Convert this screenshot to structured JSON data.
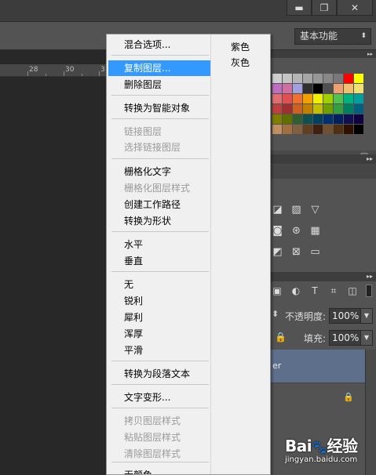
{
  "window": {
    "minimize_glyph": "▬",
    "restore_glyph": "❐",
    "close_glyph": "✕"
  },
  "options_bar": {
    "workspace_label": "基本功能",
    "workspace_arrow": "⬍"
  },
  "ruler": {
    "ticks": [
      "28",
      "30",
      "3"
    ]
  },
  "context_menu": {
    "items": [
      {
        "label": "混合选项...",
        "state": "normal"
      },
      {
        "label": "复制图层...",
        "state": "highlighted"
      },
      {
        "label": "删除图层",
        "state": "normal"
      },
      {
        "label": "转换为智能对象",
        "state": "normal"
      },
      {
        "label": "链接图层",
        "state": "disabled"
      },
      {
        "label": "选择链接图层",
        "state": "disabled"
      },
      {
        "label": "栅格化文字",
        "state": "normal"
      },
      {
        "label": "栅格化图层样式",
        "state": "disabled"
      },
      {
        "label": "创建工作路径",
        "state": "normal"
      },
      {
        "label": "转换为形状",
        "state": "normal"
      },
      {
        "label": "水平",
        "state": "normal"
      },
      {
        "label": "垂直",
        "state": "normal"
      },
      {
        "label": "无",
        "state": "normal"
      },
      {
        "label": "锐利",
        "state": "normal"
      },
      {
        "label": "犀利",
        "state": "normal"
      },
      {
        "label": "浑厚",
        "state": "normal"
      },
      {
        "label": "平滑",
        "state": "normal"
      },
      {
        "label": "转换为段落文本",
        "state": "normal"
      },
      {
        "label": "文字变形...",
        "state": "normal"
      },
      {
        "label": "拷贝图层样式",
        "state": "disabled"
      },
      {
        "label": "粘贴图层样式",
        "state": "disabled"
      },
      {
        "label": "清除图层样式",
        "state": "disabled"
      },
      {
        "label": "无颜色",
        "state": "normal"
      }
    ],
    "color_items": [
      "紫色",
      "灰色"
    ],
    "highlight_color": "#3399ff"
  },
  "swatches": {
    "colors": [
      "#cfcfcf",
      "#c4c4c4",
      "#b5b5b5",
      "#a6a6a6",
      "#979797",
      "#888888",
      "#797979",
      "#ff0000",
      "#ffff00",
      "#c06ec0",
      "#d070a0",
      "#a0a0e0",
      "#303030",
      "#000000",
      "#505050",
      "#f0a070",
      "#f0c070",
      "#f0e070",
      "#e07070",
      "#e05050",
      "#f07030",
      "#f0a000",
      "#f0f000",
      "#a0d000",
      "#50c050",
      "#00b080",
      "#00a0a0",
      "#c04040",
      "#a03030",
      "#d06020",
      "#c08000",
      "#c0c000",
      "#70a000",
      "#30a040",
      "#008060",
      "#006080",
      "#808000",
      "#607000",
      "#306030",
      "#105050",
      "#004060",
      "#003070",
      "#002060",
      "#101050",
      "#100040",
      "#c09060",
      "#a07040",
      "#806040",
      "#604020",
      "#402010",
      "#705030",
      "#503010",
      "#301000",
      "#000000"
    ]
  },
  "layers_panel": {
    "opacity_label": "不透明度:",
    "opacity_value": "100%",
    "fill_label": "填充:",
    "fill_value": "100%",
    "selected_layer_fragment": "er",
    "dropdown_glyph": "▼"
  },
  "watermark": {
    "logo_text": "Bai",
    "logo_paw": "🐾",
    "logo_suffix": "经验",
    "url": "jingyan.baidu.com"
  }
}
